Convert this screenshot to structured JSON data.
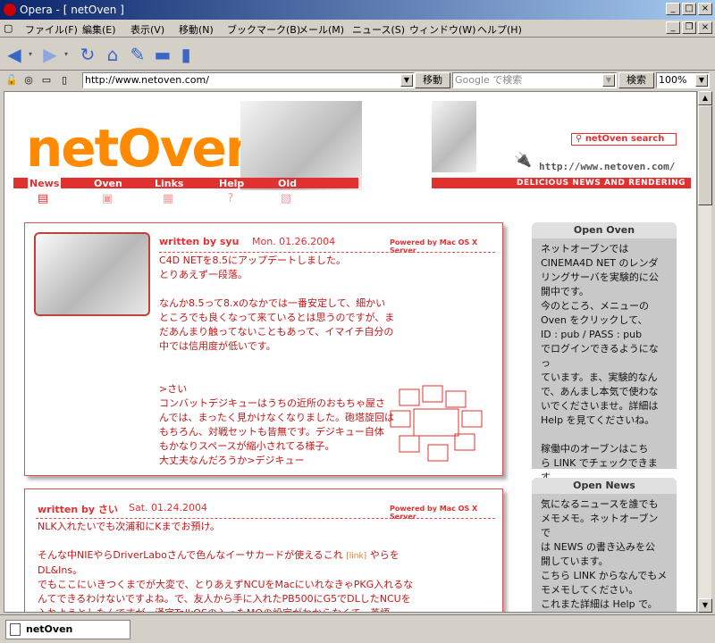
{
  "window": {
    "title": "Opera - [ netOven ]"
  },
  "menu": [
    "ファイル(F)",
    "編集(E)",
    "表示(V)",
    "移動(N)",
    "ブックマーク(B)",
    "メール(M)",
    "ニュース(S)",
    "ウィンドウ(W)",
    "ヘルプ(H)"
  ],
  "address": {
    "url": "http://www.netoven.com/",
    "go_label": "移動",
    "search_placeholder": "Google で検索",
    "search_label": "検索",
    "zoom": "100%"
  },
  "tab": {
    "label": "netOven"
  },
  "site": {
    "logo": "netOven",
    "search_link": "netOven search",
    "url_sig": "http://www.netoven.com/",
    "tagline": "DELICIOUS NEWS AND RENDERING",
    "nav": [
      "News",
      "Oven",
      "Links",
      "Help",
      "Old"
    ]
  },
  "posts": [
    {
      "author": "written by syu",
      "date": "Mon. 01.26.2004",
      "powered": "Powered by Mac OS X Server",
      "body": "C4D NETを8.5にアップデートしました。\nとりあえず一段落。\n\nなんか8.5って8.xのなかでは一番安定して、細かい\nところでも良くなって来ているとは思うのですが、ま\nだあんまり触ってないこともあって、イマイチ自分の\n中では信用度が低いです。\n\n\n>さい\nコンバットデジキューはうちの近所のおもちゃ屋さ\nんでは、まったく見かけなくなりました。砲塔旋回は\nもちろん、対戦セットも皆無です。デジキュー自体\nもかなりスペースが縮小されてる様子。\n大丈夫なんだろうか>デジキュー"
    },
    {
      "author": "written by さい",
      "date": "Sat. 01.24.2004",
      "powered": "Powered by Mac OS X Server",
      "body_a": "NLK入れたいでも次浦和にKまでお預け。\n\nそんな中NIEやらDriverLaboさんで色んなイーサカードが使えるこれ ",
      "link": "[link]",
      "body_b": " やらを\nDL&Ins。\nでもここにいきつくまでが大変で、とりあえずNCUをMacにいれなきゃPKG入れるな\nんてできるわけないですよね。で、友人から手に入れたPB500にG5でDLしたNCUを\n入れようとしたんですが、漢字TalkOSの入ったMOの設定がわからなくて、英語"
    }
  ],
  "sidebar": [
    {
      "title": "Open Oven",
      "text": "ネットオーブンでは\nCINEMA4D NET のレンダ\nリングサーバを実験的に公\n開中です。\n今のところ、メニューの\nOven をクリックして、\nID : pub / PASS : pub\nでログインできるようになっ\nています。ま、実験的なん\nで、あんまし本気で使わな\nいでくださいませ。詳細は\nHelp を見てくださいね。\n\n稼働中のオーブンはこち\nら LINK でチェックできま\nす。"
    },
    {
      "title": "Open News",
      "text": "気になるニュースを誰でも\nメモメモ。ネットオーブンで\nは NEWS の書き込みを公\n開しています。\nこちら LINK からなんでもメ\nモメモしてください。\nこれまた詳細は Help で。"
    }
  ]
}
